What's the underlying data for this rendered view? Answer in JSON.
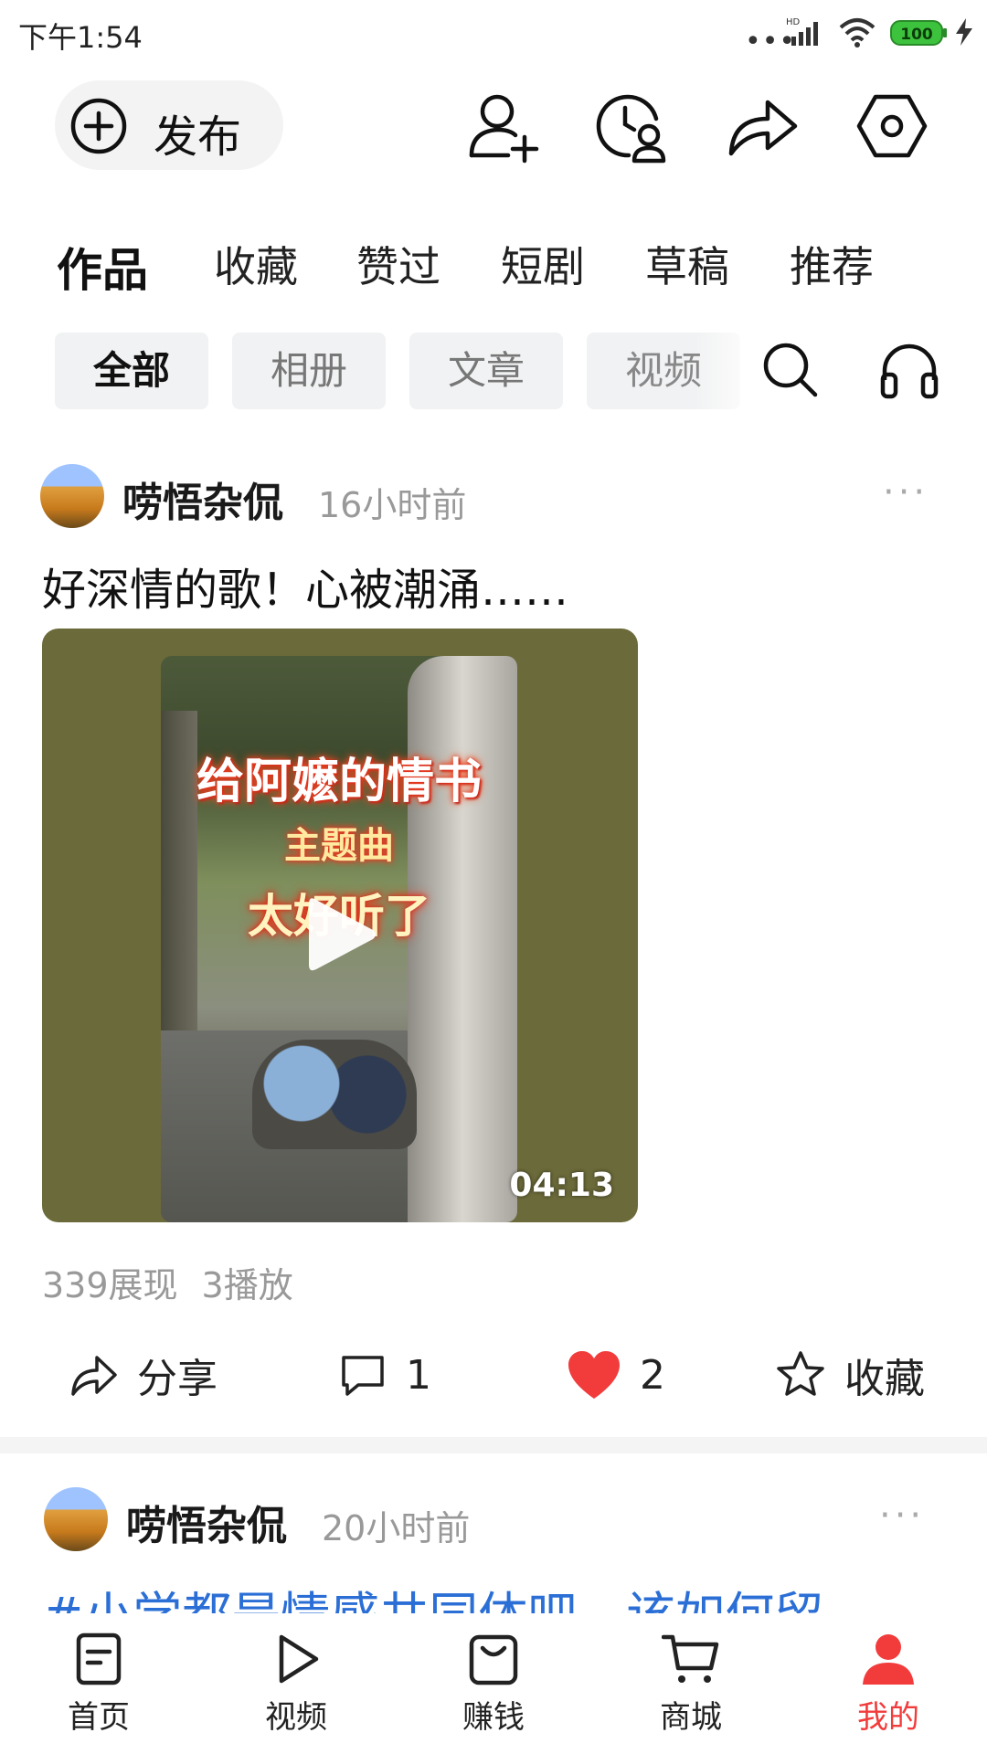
{
  "status_bar": {
    "time": "下午1:54",
    "signal_dots": "•••",
    "network": "HD",
    "battery": "100"
  },
  "toolbar": {
    "publish_label": "发布"
  },
  "tabs": [
    "作品",
    "收藏",
    "赞过",
    "短剧",
    "草稿",
    "推荐"
  ],
  "filters": [
    "全部",
    "相册",
    "文章",
    "视频"
  ],
  "posts": [
    {
      "author": "唠悟杂侃",
      "time": "16小时前",
      "more": "···",
      "text": "好深情的歌！心被潮涌……",
      "video": {
        "title_line1": "给阿嬷的情书",
        "title_line2": "主题曲",
        "title_line3": "太好听了",
        "duration": "04:13"
      },
      "impressions": "339展现",
      "plays": "3播放",
      "share_label": "分享",
      "comments": "1",
      "likes": "2",
      "favorite_label": "收藏"
    },
    {
      "author": "唠悟杂侃",
      "time": "20小时前",
      "more": "···",
      "text": "#小学都是情感共同体吧，该如何留"
    }
  ],
  "bottom_nav": [
    "首页",
    "视频",
    "赚钱",
    "商城",
    "我的"
  ],
  "colors": {
    "accent": "#f23c3c",
    "link": "#2b6fd6",
    "battery": "#3cc23c"
  }
}
